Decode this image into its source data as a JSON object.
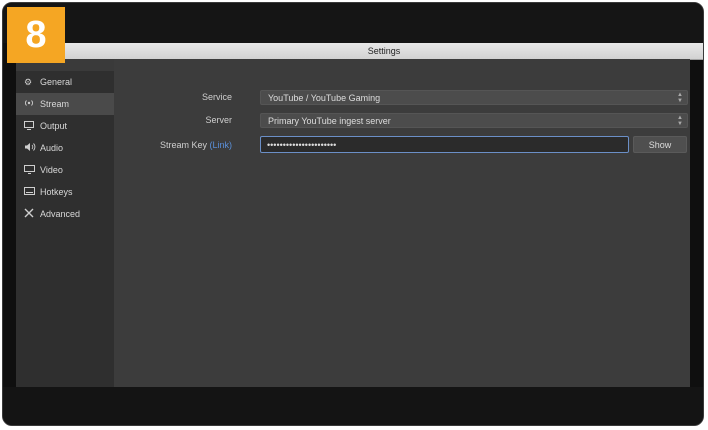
{
  "step_number": "8",
  "window": {
    "title": "Settings"
  },
  "sidebar": {
    "items": [
      {
        "label": "General",
        "icon": "gear-icon",
        "glyph": "⚙"
      },
      {
        "label": "Stream",
        "icon": "broadcast-icon",
        "glyph": "📡"
      },
      {
        "label": "Output",
        "icon": "output-icon",
        "glyph": "▭"
      },
      {
        "label": "Audio",
        "icon": "speaker-icon",
        "glyph": "◀)"
      },
      {
        "label": "Video",
        "icon": "monitor-icon",
        "glyph": "▭"
      },
      {
        "label": "Hotkeys",
        "icon": "keyboard-icon",
        "glyph": "⌨"
      },
      {
        "label": "Advanced",
        "icon": "tools-icon",
        "glyph": "✕"
      }
    ],
    "active": "Stream"
  },
  "stream": {
    "service_label": "Service",
    "service_value": "YouTube / YouTube Gaming",
    "server_label": "Server",
    "server_value": "Primary YouTube ingest server",
    "stream_key_label": "Stream Key",
    "stream_key_link": "(Link)",
    "stream_key_value": "••••••••••••••••••••••",
    "show_button": "Show"
  },
  "colors": {
    "badge": "#f5a623",
    "link": "#5a8fd8",
    "focus_border": "#6b8fc7"
  }
}
